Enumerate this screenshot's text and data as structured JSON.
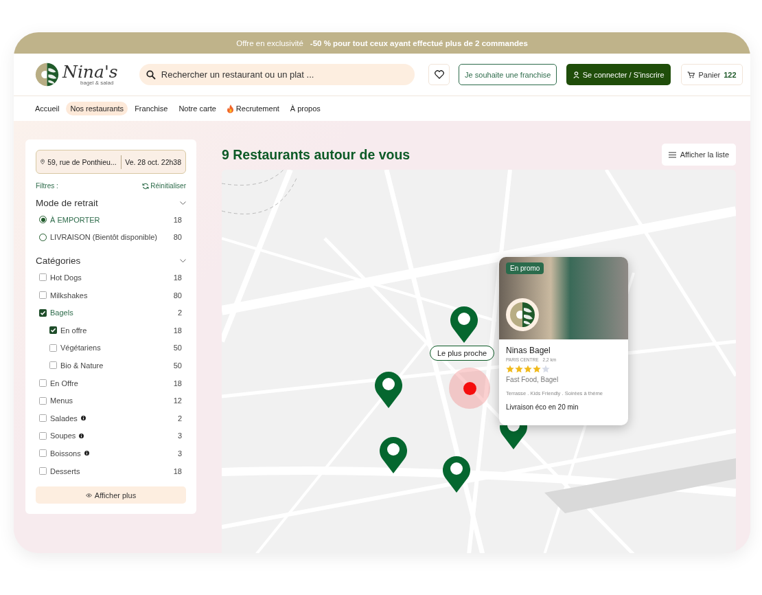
{
  "promo_banner": {
    "intro": "Offre en exclusivité",
    "offer": "-50 % pour tout ceux ayant effectué plus de 2 commandes"
  },
  "header": {
    "logo": {
      "name": "Nina's",
      "tagline": "bagel & salad"
    },
    "search": {
      "placeholder": "Rechercher un restaurant ou un plat ..."
    },
    "franchise_button": "Je souhaite une franchise",
    "login_button": "Se connecter / S'inscrire",
    "cart": {
      "label": "Panier",
      "count": "122"
    }
  },
  "nav": [
    {
      "label": "Accueil",
      "selected": false,
      "kind": "plain"
    },
    {
      "label": "Nos restaurants",
      "selected": true,
      "kind": "plain"
    },
    {
      "label": "Franchise",
      "selected": false,
      "kind": "plain"
    },
    {
      "label": "Notre carte",
      "selected": false,
      "kind": "plain"
    },
    {
      "label": "Recrutement",
      "selected": false,
      "kind": "flame"
    },
    {
      "label": "À propos",
      "selected": false,
      "kind": "plain"
    }
  ],
  "sidebar": {
    "location": {
      "address": "59, rue de Ponthieu...",
      "datetime": "Ve. 28 oct. 22h38"
    },
    "filters_label": "Filtres :",
    "reset_label": "Réinitialiser",
    "pickup_title": "Mode de retrait",
    "pickup_modes": [
      {
        "label": "À EMPORTER",
        "count": "18",
        "selected": true
      },
      {
        "label": "LIVRAISON (Bientôt disponible)",
        "count": "80",
        "selected": false
      }
    ],
    "categories_title": "Catégories",
    "categories": [
      {
        "label": "Hot Dogs",
        "count": "18",
        "checked": false,
        "info": false
      },
      {
        "label": "Milkshakes",
        "count": "80",
        "checked": false,
        "info": false
      },
      {
        "label": "Bagels",
        "count": "2",
        "checked": true,
        "info": false,
        "children": [
          {
            "label": "En offre",
            "count": "18",
            "checked": true
          },
          {
            "label": "Végétariens",
            "count": "50",
            "checked": false
          },
          {
            "label": "Bio & Nature",
            "count": "50",
            "checked": false
          }
        ]
      },
      {
        "label": "En Offre",
        "count": "18",
        "checked": false,
        "info": false
      },
      {
        "label": "Menus",
        "count": "12",
        "checked": false,
        "info": false
      },
      {
        "label": "Salades",
        "count": "2",
        "checked": false,
        "info": true
      },
      {
        "label": "Soupes",
        "count": "3",
        "checked": false,
        "info": true
      },
      {
        "label": "Boissons",
        "count": "3",
        "checked": false,
        "info": true
      },
      {
        "label": "Desserts",
        "count": "18",
        "checked": false,
        "info": false
      }
    ],
    "show_more": "Afficher plus"
  },
  "main": {
    "title": "9 Restaurants autour de vous",
    "list_button": "Afficher la liste"
  },
  "map": {
    "nearest_label": "Le plus proche",
    "card": {
      "badge": "En promo",
      "name": "Ninas Bagel",
      "area": "PARIS CENTRE",
      "distance": "2,2 km",
      "stars": 4,
      "cuisine": "Fast Food, Bagel",
      "tags": "Terrasse . Kids Friendly . Soirées à thème",
      "delivery": "Livraison éco en 20 min"
    }
  }
}
